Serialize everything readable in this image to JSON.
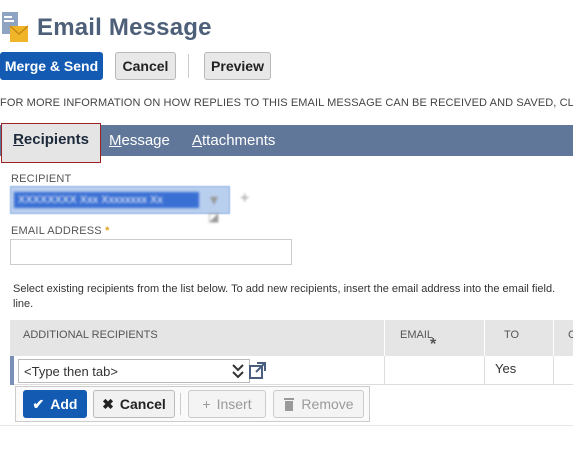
{
  "page": {
    "title": "Email Message",
    "title_icon": "email-document-icon"
  },
  "toolbar": {
    "merge_send": "Merge & Send",
    "cancel": "Cancel",
    "preview": "Preview"
  },
  "notice": "FOR MORE INFORMATION ON HOW REPLIES TO THIS EMAIL MESSAGE CAN BE RECEIVED AND SAVED, CL",
  "tabs": [
    {
      "label": "Recipients",
      "underline": "R",
      "rest": "ecipients",
      "active": true
    },
    {
      "label": "Message",
      "underline": "M",
      "rest": "essage",
      "active": false
    },
    {
      "label": "Attachments",
      "underline": "A",
      "rest": "ttachments",
      "active": false
    }
  ],
  "recipient": {
    "label": "RECIPIENT",
    "value": "XXXXXXXX Xxx Xxxxxxxx Xx"
  },
  "email_address": {
    "label": "EMAIL ADDRESS",
    "required_mark": "*",
    "value": ""
  },
  "help_text": "Select existing recipients from the list below. To add new recipients, insert the email address into the email field. line.",
  "grid": {
    "columns": [
      "ADDITIONAL RECIPIENTS",
      "EMAIL",
      "TO",
      "C"
    ],
    "email_required_mark": "*",
    "row": {
      "placeholder": "<Type then tab>",
      "to": "Yes"
    }
  },
  "row_actions": {
    "add": "Add",
    "cancel": "Cancel",
    "insert": "Insert",
    "remove": "Remove"
  },
  "colors": {
    "primary": "#125ab2",
    "tabbar": "#607799",
    "title": "#4d5f79",
    "required": "#e3a324"
  }
}
